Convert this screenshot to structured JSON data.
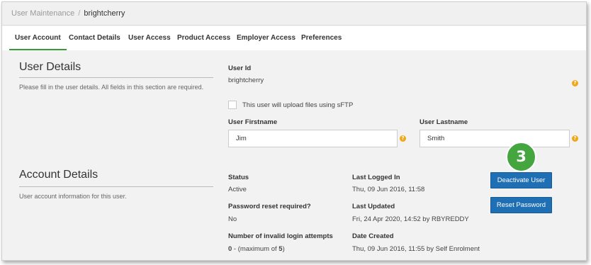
{
  "breadcrumb": {
    "parent": "User Maintenance",
    "separator": "/",
    "current": "brightcherry"
  },
  "tabs": [
    {
      "label": "User Account",
      "active": true
    },
    {
      "label": "Contact Details",
      "active": false
    },
    {
      "label": "User Access",
      "active": false
    },
    {
      "label": "Product Access",
      "active": false
    },
    {
      "label": "Employer Access",
      "active": false
    },
    {
      "label": "Preferences",
      "active": false
    }
  ],
  "user_details": {
    "title": "User Details",
    "description": "Please fill in the user details. All fields in this section are required.",
    "user_id_label": "User Id",
    "user_id_value": "brightcherry",
    "sftp_label": "This user will upload files using sFTP",
    "sftp_checked": false,
    "firstname_label": "User Firstname",
    "firstname_value": "Jim",
    "lastname_label": "User Lastname",
    "lastname_value": "Smith",
    "help_glyph": "?"
  },
  "account_details": {
    "title": "Account Details",
    "description": "User account information for this user.",
    "status_label": "Status",
    "status_value": "Active",
    "password_reset_label": "Password reset required?",
    "password_reset_value": "No",
    "invalid_attempts_label": "Number of invalid login attempts",
    "invalid_attempts_count": "0",
    "invalid_attempts_mid": " - (maximum of ",
    "invalid_attempts_max": "5",
    "invalid_attempts_end": ")",
    "last_logged_in_label": "Last Logged In",
    "last_logged_in_value": "Thu, 09 Jun 2016, 11:58",
    "last_updated_label": "Last Updated",
    "last_updated_value": "Fri, 24 Apr 2020, 14:52 by RBYREDDY",
    "date_created_label": "Date Created",
    "date_created_value": "Thu, 09 Jun 2016, 11:55 by Self Enrolment",
    "deactivate_button": "Deactivate User",
    "reset_password_button": "Reset Password"
  },
  "step_badge": "3",
  "colors": {
    "accent_green": "#45a640",
    "tab_underline": "#3a9a3a",
    "button_blue": "#1f6fb4",
    "help_orange": "#f0a818"
  }
}
